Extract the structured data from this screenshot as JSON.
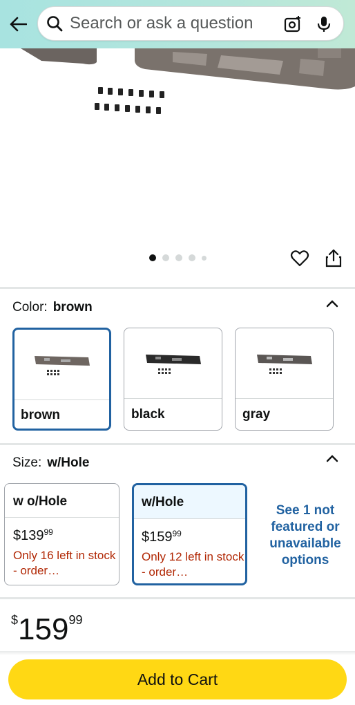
{
  "search": {
    "placeholder": "Search or ask a question"
  },
  "gallery": {
    "total_images": 5,
    "active_index": 0
  },
  "color": {
    "label": "Color:",
    "selected": "brown",
    "options": [
      {
        "name": "brown",
        "selected": true
      },
      {
        "name": "black",
        "selected": false
      },
      {
        "name": "gray",
        "selected": false
      }
    ]
  },
  "size": {
    "label": "Size:",
    "selected": "w/Hole",
    "options": [
      {
        "name": "w o/Hole",
        "price_dollars": "139",
        "price_cents": "99",
        "stock": "Only 16 left in stock - order…",
        "selected": false
      },
      {
        "name": "w/Hole",
        "price_dollars": "159",
        "price_cents": "99",
        "stock": "Only 12 left in stock - order…",
        "selected": true
      }
    ],
    "see_more": "See 1 not featured or unavailable options"
  },
  "price": {
    "currency": "$",
    "dollars": "159",
    "cents": "99"
  },
  "actions": {
    "add_to_cart": "Add to Cart"
  },
  "colors": {
    "accent_blue": "#2162a1",
    "cart_yellow": "#ffd814",
    "stock_red": "#b12704"
  }
}
